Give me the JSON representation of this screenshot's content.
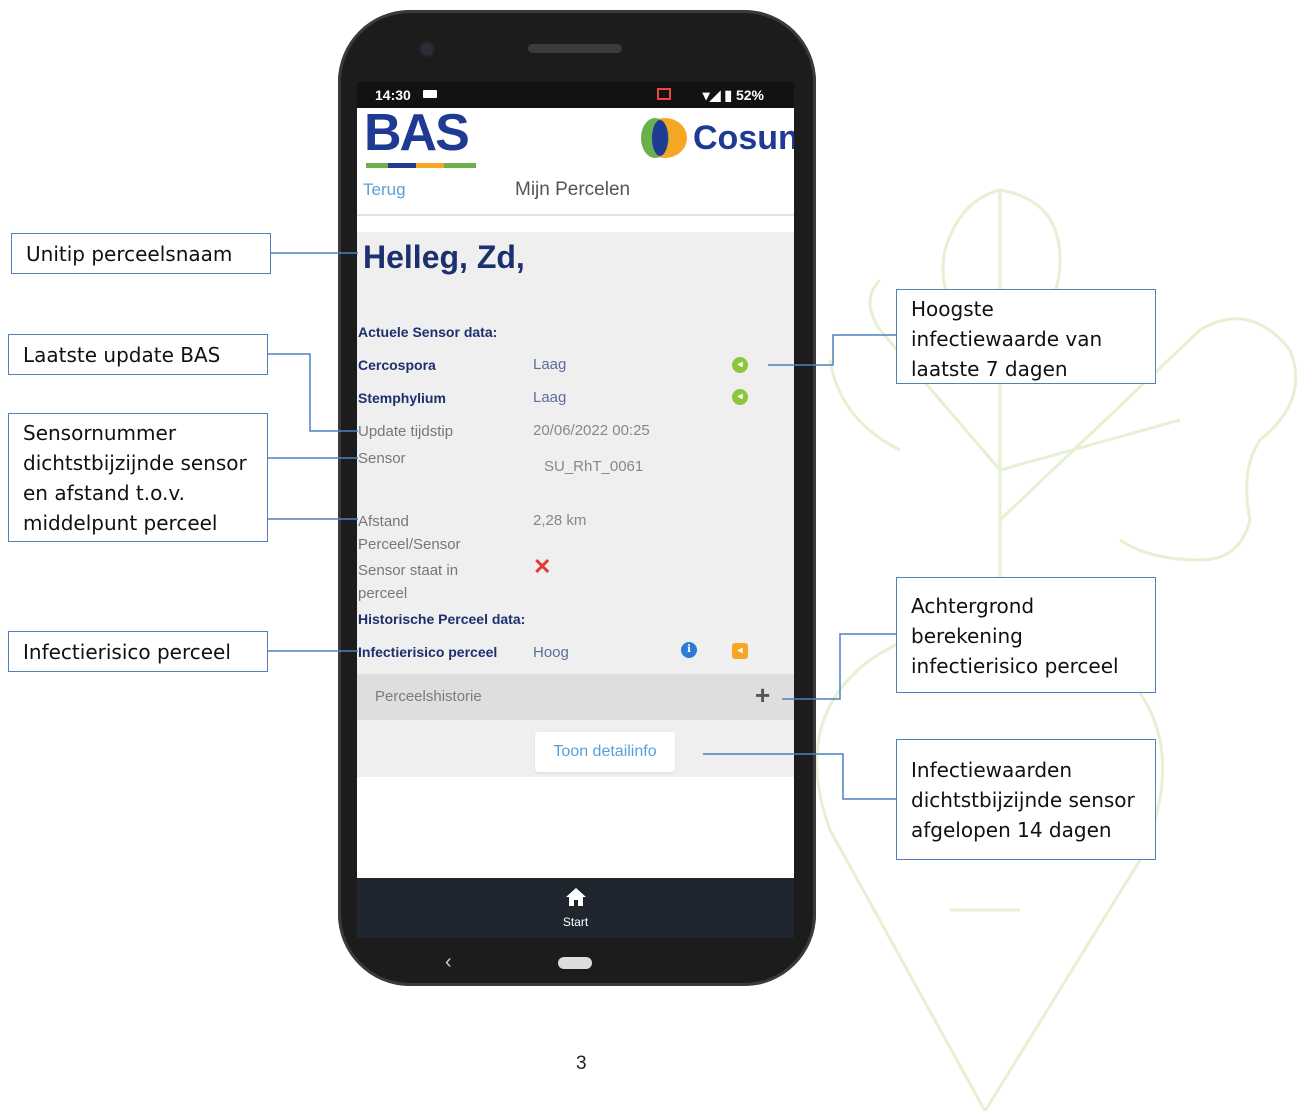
{
  "status": {
    "time": "14:30",
    "battery": "52%"
  },
  "header": {
    "bas_logo": "BAS",
    "cosun_logo": "Cosun"
  },
  "nav": {
    "back": "Terug",
    "title": "Mijn Percelen"
  },
  "parcel": {
    "name": "Helleg, Zd,"
  },
  "sensor_section": {
    "heading": "Actuele Sensor data:",
    "cercospora": {
      "label": "Cercospora",
      "value": "Laag"
    },
    "stemphylium": {
      "label": "Stemphylium",
      "value": "Laag"
    },
    "update": {
      "label": "Update tijdstip",
      "value": "20/06/2022 00:25"
    },
    "sensor": {
      "label": "Sensor",
      "value": "SU_RhT_0061"
    },
    "distance": {
      "label_1": "Afstand",
      "label_2": "Perceel/Sensor",
      "value": "2,28 km"
    },
    "in_parcel": {
      "label_1": "Sensor staat in",
      "label_2": "perceel",
      "value_icon": "red-cross-icon"
    }
  },
  "history_section": {
    "heading": "Historische Perceel data:",
    "risk": {
      "label": "Infectierisico perceel",
      "value": "Hoog"
    },
    "history_label": "Perceelshistorie",
    "detail_button": "Toon detailinfo"
  },
  "bottom_nav": {
    "start": "Start"
  },
  "colors": {
    "low": "#8dc63f",
    "high": "#f5a623",
    "info": "#2d7bd6",
    "cross": "#e53935",
    "brand": "#1f3a93"
  },
  "callouts": {
    "parcel_name": "Unitip perceelsnaam",
    "last_update": "Laatste update BAS",
    "sensor_number": [
      "Sensornummer",
      "dichtstbijzijnde sensor",
      "en afstand t.o.v.",
      "middelpunt perceel"
    ],
    "risk": "Infectierisico perceel",
    "highest_value": [
      "Hoogste",
      "infectiewaarde van",
      "laatste 7 dagen"
    ],
    "background": [
      "Achtergrond",
      "berekening",
      "infectierisico perceel"
    ],
    "values": [
      "Infectiewaarden",
      "dichtstbijzijnde sensor",
      "afgelopen 14 dagen"
    ]
  },
  "page_number": "3"
}
